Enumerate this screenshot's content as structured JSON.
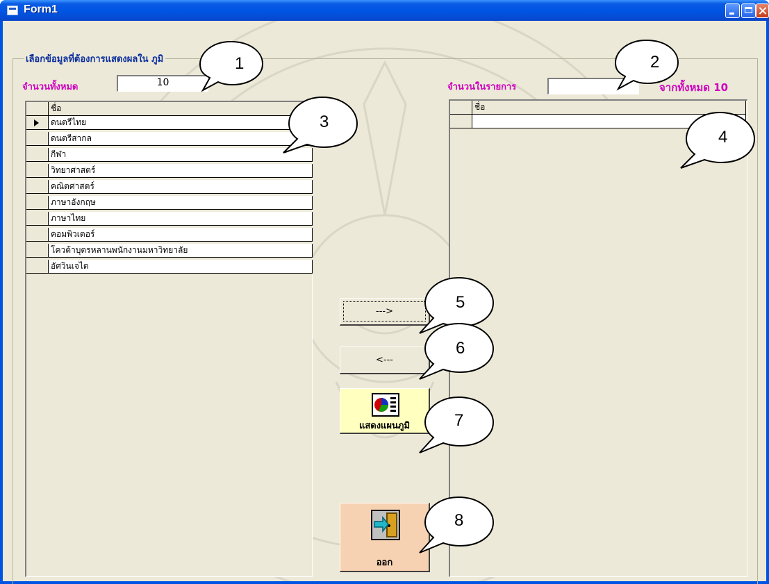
{
  "window": {
    "title": "Form1"
  },
  "group": {
    "caption": "เลือกข้อมูลที่ต้องการแสดงผลใน                ภูมิ"
  },
  "left_panel": {
    "total_label": "จำนวนทั้งหมด",
    "total_value": "10",
    "grid": {
      "header": "ชื่อ",
      "rows": [
        "ดนตรีไทย",
        "ดนตรีสากล",
        "กีฬา",
        "วิทยาศาสตร์",
        "คณิตศาสตร์",
        "ภาษาอังกฤษ",
        "ภาษาไทย",
        "คอมพิวเตอร์",
        "โควต้าบุตรหลานพนักงานมหาวิทยาลัย",
        "อัศวินเจได"
      ]
    }
  },
  "right_panel": {
    "count_label": "จำนวนในรายการ",
    "count_value": "",
    "total_suffix": "จากทั้งหมด 10",
    "grid": {
      "header": "ชื่อ",
      "rows": [
        ""
      ]
    }
  },
  "buttons": {
    "add": "--->",
    "remove": "<---",
    "chart": "แสดงแผนภูมิ",
    "exit": "ออก"
  },
  "callouts": [
    "1",
    "2",
    "3",
    "4",
    "5",
    "6",
    "7",
    "8"
  ]
}
